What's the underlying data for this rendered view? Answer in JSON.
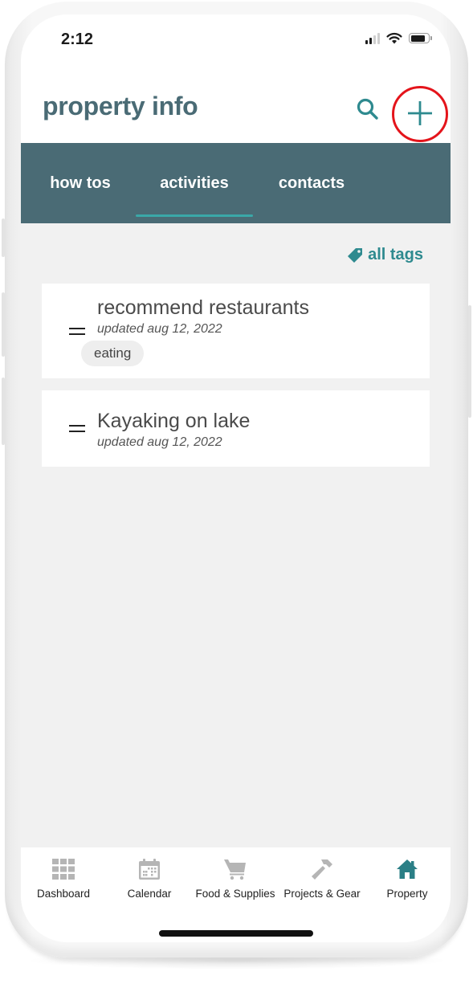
{
  "status_bar": {
    "time": "2:12",
    "signal_bars_active": 2,
    "signal_bars_total": 4
  },
  "header": {
    "title": "property info",
    "search_icon": "search-icon",
    "add_icon": "plus-icon",
    "highlight_color": "#e4141b"
  },
  "tabs": [
    {
      "label": "how tos",
      "active": false
    },
    {
      "label": "activities",
      "active": true
    },
    {
      "label": "contacts",
      "active": false
    }
  ],
  "filter": {
    "label": "all tags",
    "icon": "tag-icon"
  },
  "cards": [
    {
      "title": "recommend restaurants",
      "updated": "updated aug 12, 2022",
      "tags": [
        "eating"
      ]
    },
    {
      "title": "Kayaking on lake",
      "updated": "updated aug 12, 2022",
      "tags": []
    }
  ],
  "bottom_nav": [
    {
      "label": "Dashboard",
      "icon": "grid-icon",
      "active": false
    },
    {
      "label": "Calendar",
      "icon": "calendar-icon",
      "active": false
    },
    {
      "label": "Food & Supplies",
      "icon": "cart-icon",
      "active": false
    },
    {
      "label": "Projects & Gear",
      "icon": "hammer-icon",
      "active": false
    },
    {
      "label": "Property",
      "icon": "home-icon",
      "active": true
    }
  ],
  "colors": {
    "brand": "#4a6b75",
    "accent": "#2e8a8f",
    "tab_indicator": "#3aa8a8",
    "inactive_icon": "#b5b5b5",
    "background": "#f1f1f1"
  }
}
